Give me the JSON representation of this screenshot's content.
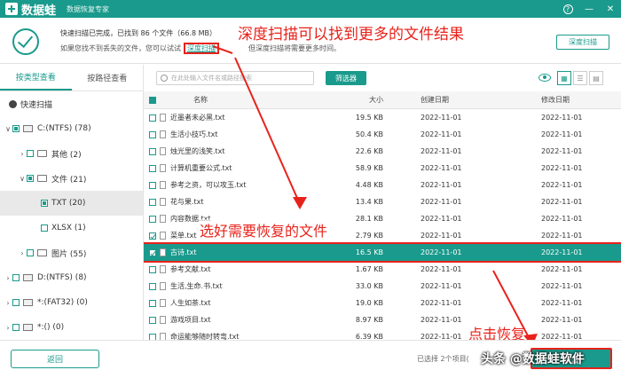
{
  "app": {
    "name": "数据蛙",
    "subtitle": "数据恢复专家",
    "help": "?",
    "min": "—",
    "close": "✕"
  },
  "status": {
    "line1": "快速扫描已完成，已找到 86 个文件（66.8 MB）",
    "line2_prefix": "如果您找不到丢失的文件，您可以试试",
    "deep_link": "深度扫描",
    "line2_suffix": "但深度扫描将需要更多时间。",
    "deep_button": "深度扫描"
  },
  "annotations": {
    "top": "深度扫描可以找到更多的文件结果",
    "middle": "选好需要恢复的文件",
    "bottom": "点击恢复"
  },
  "sidebar": {
    "tabs": [
      "按类型查看",
      "按路径查看"
    ],
    "quick_scan": "快速扫描",
    "items": [
      {
        "label": "C:(NTFS) (78)"
      },
      {
        "label": "其他 (2)"
      },
      {
        "label": "文件 (21)"
      },
      {
        "label": "TXT (20)"
      },
      {
        "label": "XLSX (1)"
      },
      {
        "label": "图片 (55)"
      },
      {
        "label": "D:(NTFS) (8)"
      },
      {
        "label": "*:(FAT32) (0)"
      },
      {
        "label": "*:() (0)"
      }
    ]
  },
  "toolbar": {
    "search_placeholder": "在此处输入文件名或路径搜索",
    "filter_label": "筛选器"
  },
  "table": {
    "headers": {
      "name": "名称",
      "size": "大小",
      "created": "创建日期",
      "modified": "修改日期"
    },
    "rows": [
      {
        "name": "近墨者未必黑.txt",
        "size": "19.5 KB",
        "created": "2022-11-01",
        "modified": "2022-11-01",
        "checked": false,
        "highlight": false
      },
      {
        "name": "生活小技巧.txt",
        "size": "50.4 KB",
        "created": "2022-11-01",
        "modified": "2022-11-01",
        "checked": false,
        "highlight": false
      },
      {
        "name": "烛光里的浅笑.txt",
        "size": "22.6 KB",
        "created": "2022-11-01",
        "modified": "2022-11-01",
        "checked": false,
        "highlight": false
      },
      {
        "name": "计算机重要公式.txt",
        "size": "58.9 KB",
        "created": "2022-11-01",
        "modified": "2022-11-01",
        "checked": false,
        "highlight": false
      },
      {
        "name": "参考之资，可以攻玉.txt",
        "size": "4.48 KB",
        "created": "2022-11-01",
        "modified": "2022-11-01",
        "checked": false,
        "highlight": false
      },
      {
        "name": "花与果.txt",
        "size": "13.4 KB",
        "created": "2022-11-01",
        "modified": "2022-11-01",
        "checked": false,
        "highlight": false
      },
      {
        "name": "内容数据.txt",
        "size": "28.1 KB",
        "created": "2022-11-01",
        "modified": "2022-11-01",
        "checked": false,
        "highlight": false
      },
      {
        "name": "菜单.txt",
        "size": "2.79 KB",
        "created": "2022-11-01",
        "modified": "2022-11-01",
        "checked": true,
        "highlight": false
      },
      {
        "name": "古诗.txt",
        "size": "16.5 KB",
        "created": "2022-11-01",
        "modified": "2022-11-01",
        "checked": true,
        "highlight": true
      },
      {
        "name": "参考文献.txt",
        "size": "1.67 KB",
        "created": "2022-11-01",
        "modified": "2022-11-01",
        "checked": false,
        "highlight": false
      },
      {
        "name": "生活,生命.书.txt",
        "size": "33.0 KB",
        "created": "2022-11-01",
        "modified": "2022-11-01",
        "checked": false,
        "highlight": false
      },
      {
        "name": "人生如茶.txt",
        "size": "19.0 KB",
        "created": "2022-11-01",
        "modified": "2022-11-01",
        "checked": false,
        "highlight": false
      },
      {
        "name": "游戏项目.txt",
        "size": "8.97 KB",
        "created": "2022-11-01",
        "modified": "2022-11-01",
        "checked": false,
        "highlight": false
      },
      {
        "name": "命运能够随时转弯.txt",
        "size": "6.39 KB",
        "created": "2022-11-01",
        "modified": "2022-11-01",
        "checked": false,
        "highlight": false
      }
    ]
  },
  "footer": {
    "back": "返回",
    "selected": "已选择 2个项目(",
    "recover": "恢复"
  },
  "watermark": "头条 @数据蛙软件",
  "colors": {
    "accent": "#1a9a8c",
    "annotation": "#e8221b"
  }
}
